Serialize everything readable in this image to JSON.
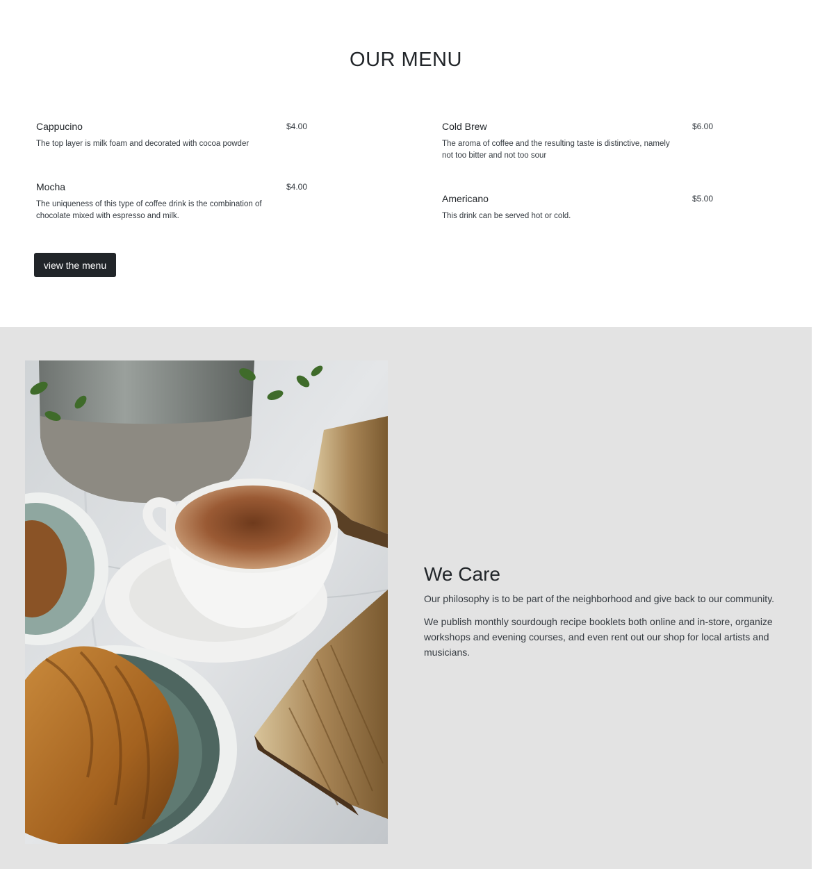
{
  "menu": {
    "title": "OUR MENU",
    "items_left": [
      {
        "name": "Cappucino",
        "price": "$4.00",
        "description": "The top layer is milk foam and decorated with cocoa powder"
      },
      {
        "name": "Mocha",
        "price": "$4.00",
        "description": "The uniqueness of this type of coffee drink is the combination of chocolate mixed with espresso and milk."
      }
    ],
    "items_right": [
      {
        "name": "Cold Brew",
        "price": "$6.00",
        "description": "The aroma of coffee and the resulting taste is distinctive, namely not too bitter and not too sour"
      },
      {
        "name": "Americano",
        "price": "$5.00",
        "description": "This drink can be served hot or cold."
      }
    ],
    "button_label": "view the menu"
  },
  "care": {
    "heading": "We Care",
    "paragraph_1": "Our philosophy is to be part of the neighborhood and give back to our community.",
    "paragraph_2": "We publish monthly sourdough recipe booklets both online and in-store, organize workshops and evening courses, and even rent out our shop for local artists and musicians."
  },
  "colors": {
    "button_bg": "#212529",
    "care_bg": "#e3e3e3",
    "text": "#212529"
  }
}
